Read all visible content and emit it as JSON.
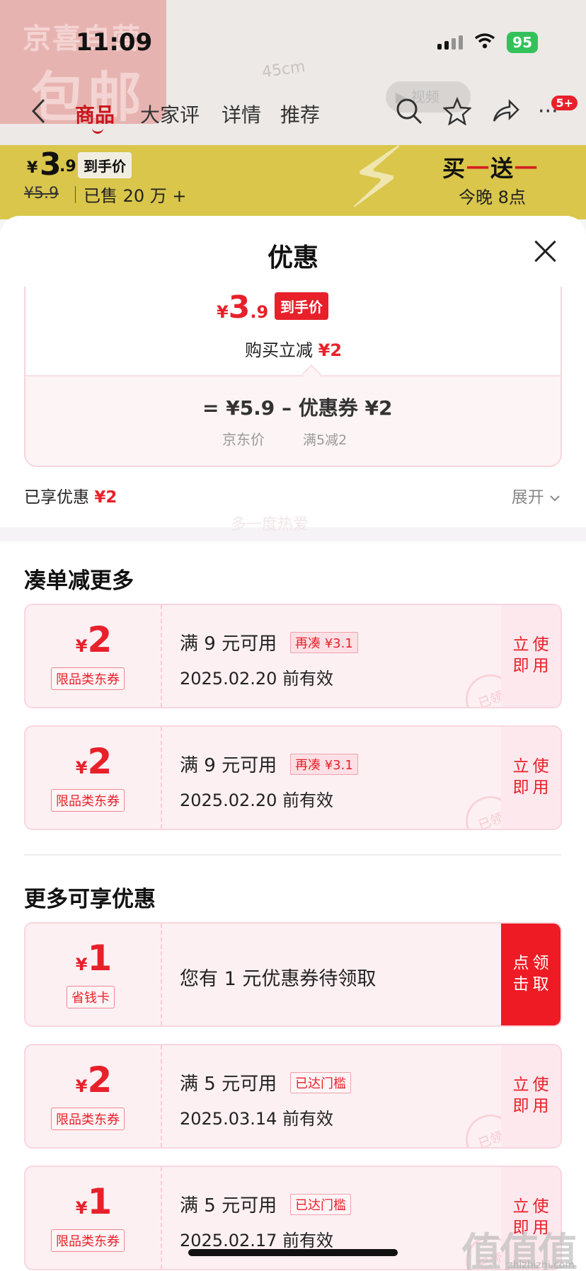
{
  "status_bar": {
    "time": "11:09",
    "battery": "95"
  },
  "background": {
    "badge_line1": "京喜自营",
    "badge_line2": "包邮",
    "size_text": "45cm",
    "video_label": "▶ 视频",
    "nav": {
      "tabs": [
        "商品",
        "大家评",
        "详情",
        "推荐"
      ],
      "more_badge": "5+"
    },
    "promo": {
      "yen": "¥",
      "price_int": "3",
      "price_dec": ".9",
      "price_tag": "到手价",
      "original_price": "¥5.9",
      "sold": "已售 20 万 +",
      "right_line1_a": "买",
      "right_line1_b": "一",
      "right_line1_c": "送",
      "right_line1_d": "一",
      "right_line2": "今晚 8点"
    }
  },
  "sheet": {
    "title": "优惠",
    "calc": {
      "yen": "¥",
      "price_int": "3",
      "price_dec": ".9",
      "price_tag": "到手价",
      "direct_label": "购买立减",
      "direct_amount": "¥2",
      "formula": "=  ¥5.9  –  优惠券 ¥2",
      "sub1": "京东价",
      "sub2": "满5减2"
    },
    "enjoyed_label": "已享优惠",
    "enjoyed_amount": "¥2",
    "expand_label": "展开",
    "section1_title": "凑单减更多",
    "section2_title": "更多可享优惠",
    "watermark": "多一度热爱",
    "coupons_section1": [
      {
        "yen": "¥",
        "amount": "2",
        "type": "限品类东券",
        "condition": "满 9 元可用",
        "chip": "再凑 ¥3.1",
        "date": "2025.02.20 前有效",
        "button": "立即使用",
        "stamp": "已领"
      },
      {
        "yen": "¥",
        "amount": "2",
        "type": "限品类东券",
        "condition": "满 9 元可用",
        "chip": "再凑 ¥3.1",
        "date": "2025.02.20 前有效",
        "button": "立即使用",
        "stamp": "已领"
      }
    ],
    "coupons_section2": [
      {
        "yen": "¥",
        "amount": "1",
        "type": "省钱卡",
        "text": "您有 1 元优惠券待领取",
        "button": "点击领取"
      },
      {
        "yen": "¥",
        "amount": "2",
        "type": "限品类东券",
        "condition": "满 5 元可用",
        "chip": "已达门槛",
        "date": "2025.03.14 前有效",
        "button": "立即使用",
        "stamp": "已领"
      },
      {
        "yen": "¥",
        "amount": "1",
        "type": "限品类东券",
        "condition": "满 5 元可用",
        "chip": "已达门槛",
        "date": "2025.02.17 前有效",
        "button": "立即使用",
        "stamp": "已领"
      }
    ]
  },
  "site_watermark": {
    "mark": "值值值",
    "url": "zhizhizhi.com"
  },
  "colors": {
    "accent": "#e8202a",
    "coupon_bg": "#fdf0f3",
    "promo_bar": "#d9c64a"
  }
}
